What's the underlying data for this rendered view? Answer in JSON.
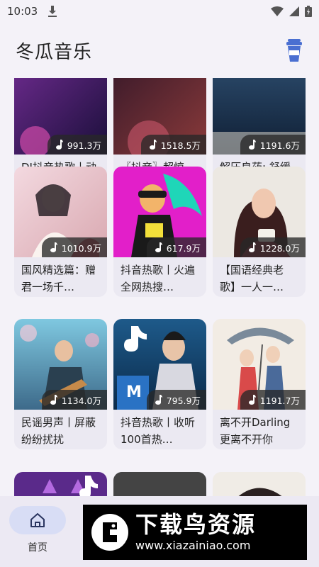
{
  "status_bar": {
    "time": "10:03"
  },
  "app_bar": {
    "title": "冬瓜音乐"
  },
  "cards": [
    {
      "plays": "991.3万",
      "title": "DJ抖音热歌丨动感节奏，…"
    },
    {
      "plays": "1518.5万",
      "title": "〖抖音〗超惊艳！网红国…"
    },
    {
      "plays": "1191.6万",
      "title": "解压良药: 舒缓惬意的轻…"
    },
    {
      "plays": "1010.9万",
      "title": "国风精选篇：赠君一场千…"
    },
    {
      "plays": "617.9万",
      "title": "抖音热歌丨火遍全网热搜…"
    },
    {
      "plays": "1228.0万",
      "title": "【国语经典老歌】一人一…"
    },
    {
      "plays": "1134.0万",
      "title": "民谣男声丨屏蔽纷纷扰扰"
    },
    {
      "plays": "795.9万",
      "title": "抖音热歌丨收听100首热…"
    },
    {
      "plays": "1191.7万",
      "title": "离不开Darling更离不开你"
    }
  ],
  "bottom_nav": {
    "home_label": "首页"
  },
  "watermark": {
    "title": "下载鸟资源",
    "url": "www.xiazainiao.com"
  }
}
